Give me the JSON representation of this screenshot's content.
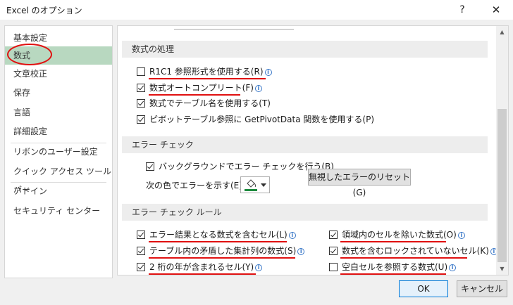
{
  "window": {
    "title": "Excel のオプション",
    "help_label": "?",
    "close_label": "✕"
  },
  "sidebar": {
    "items": [
      {
        "label": "基本設定"
      },
      {
        "label": "数式",
        "active": true
      },
      {
        "label": "文章校正"
      },
      {
        "label": "保存"
      },
      {
        "label": "言語"
      },
      {
        "label": "詳細設定"
      },
      {
        "label": "リボンのユーザー設定"
      },
      {
        "label": "クイック アクセス ツール バー"
      },
      {
        "label": "アドイン"
      },
      {
        "label": "セキュリティ センター"
      }
    ]
  },
  "sections": {
    "calculation": {
      "header": "数式の処理",
      "options": [
        {
          "label": "R1C1 参照形式を使用する(R)",
          "checked": false,
          "info": true
        },
        {
          "label": "数式オートコンプリート(F)",
          "checked": true,
          "info": true
        },
        {
          "label": "数式でテーブル名を使用する(T)",
          "checked": true,
          "info": false
        },
        {
          "label": "ピボットテーブル参照に GetPivotData 関数を使用する(P)",
          "checked": true,
          "info": false
        }
      ]
    },
    "error_check": {
      "header": "エラー チェック",
      "background_label": "バックグラウンドでエラー チェックを行う(B)",
      "background_checked": true,
      "color_label": "次の色でエラーを示す(E):",
      "color_icon": "paint-bucket-icon",
      "color_value": "#1d8a3e",
      "reset_button": "無視したエラーのリセット(G)"
    },
    "error_rules": {
      "header": "エラー チェック ルール",
      "left": [
        {
          "label": "エラー結果となる数式を含むセル(L)",
          "checked": true
        },
        {
          "label": "テーブル内の矛盾した集計列の数式(S)",
          "checked": true
        },
        {
          "label": "2 桁の年が含まれるセル(Y)",
          "checked": true
        }
      ],
      "right": [
        {
          "label": "領域内のセルを除いた数式(O)",
          "checked": true
        },
        {
          "label": "数式を含むロックされていないセル(K)",
          "checked": true
        },
        {
          "label": "空白セルを参照する数式(U)",
          "checked": false
        }
      ]
    }
  },
  "footer": {
    "ok": "OK",
    "cancel": "キャンセル"
  },
  "colors": {
    "annotation_red": "#e01010",
    "active_sidebar": "#b8d8c0"
  }
}
